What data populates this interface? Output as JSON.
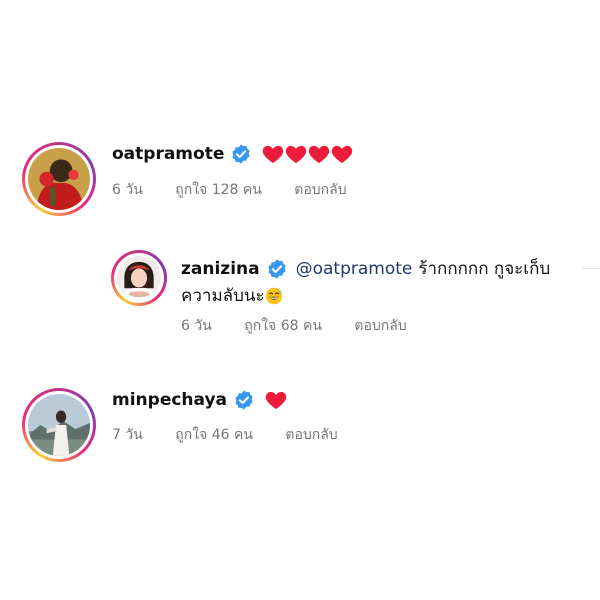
{
  "comments": [
    {
      "username": "oatpramote",
      "verified": true,
      "text_emoji": "heart",
      "heart_count": 4,
      "time": "6 วัน",
      "likes": "ถูกใจ 128 คน",
      "reply": "ตอบกลับ"
    },
    {
      "username": "zanizina",
      "verified": true,
      "mention": "@oatpramote",
      "text_line1": "ร้ากกกกก กูจะเก็บ",
      "text_line2": "ความลับนะ",
      "text_emoji": "grinning-sweat-face",
      "time": "6 วัน",
      "likes": "ถูกใจ 68 คน",
      "reply": "ตอบกลับ"
    },
    {
      "username": "minpechaya",
      "verified": true,
      "text_emoji": "heart",
      "heart_count": 1,
      "time": "7 วัน",
      "likes": "ถูกใจ 46 คน",
      "reply": "ตอบกลับ"
    }
  ],
  "colors": {
    "verified_badge": "#3897f0",
    "heart": "#ed1c3a",
    "mention": "#1f3a6a",
    "meta_text": "#777777"
  }
}
